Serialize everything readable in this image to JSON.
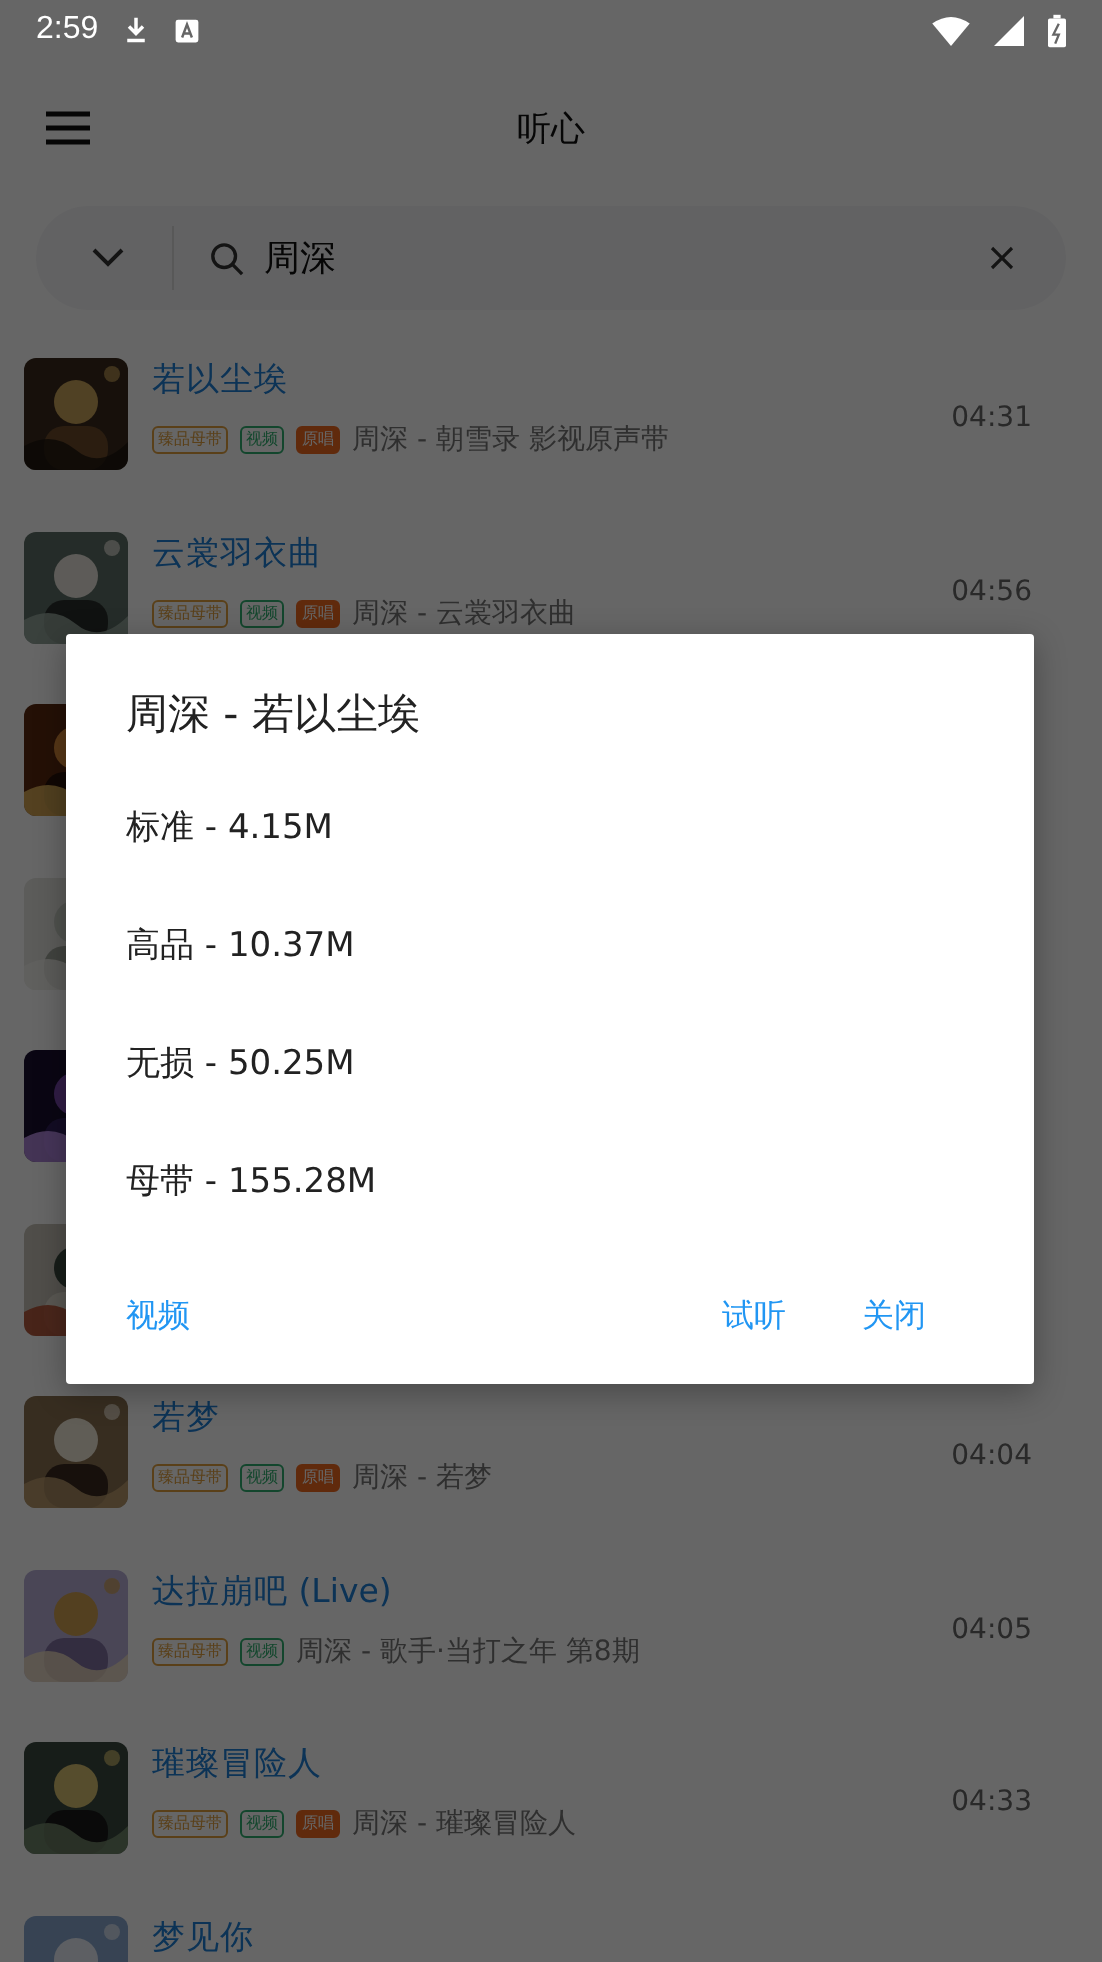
{
  "status_bar": {
    "time": "2:59"
  },
  "app_bar": {
    "title": "听心"
  },
  "search": {
    "value": "周深"
  },
  "songs": [
    {
      "kind": "song",
      "title": "若以尘埃",
      "tags": [
        {
          "label": "臻品母带",
          "kind": "quality"
        },
        {
          "label": "视频",
          "kind": "video"
        },
        {
          "label": "原唱",
          "kind": "original"
        }
      ],
      "subtitle": "周深 - 朝雪录 影视原声带",
      "duration": "04:31"
    },
    {
      "kind": "song",
      "title": "云裳羽衣曲",
      "tags": [
        {
          "label": "臻品母带",
          "kind": "quality"
        },
        {
          "label": "视频",
          "kind": "video"
        },
        {
          "label": "原唱",
          "kind": "original"
        }
      ],
      "subtitle": "周深 - 云裳羽衣曲",
      "duration": "04:56"
    },
    {
      "kind": "covered"
    },
    {
      "kind": "covered"
    },
    {
      "kind": "covered"
    },
    {
      "kind": "covered"
    },
    {
      "kind": "song",
      "title": "若梦",
      "tags": [
        {
          "label": "臻品母带",
          "kind": "quality"
        },
        {
          "label": "视频",
          "kind": "video"
        },
        {
          "label": "原唱",
          "kind": "original"
        }
      ],
      "subtitle": "周深 - 若梦",
      "duration": "04:04"
    },
    {
      "kind": "song",
      "title": "达拉崩吧 (Live)",
      "tags": [
        {
          "label": "臻品母带",
          "kind": "quality"
        },
        {
          "label": "视频",
          "kind": "video"
        }
      ],
      "subtitle": "周深 - 歌手·当打之年 第8期",
      "duration": "04:05"
    },
    {
      "kind": "song",
      "title": "璀璨冒险人",
      "tags": [
        {
          "label": "臻品母带",
          "kind": "quality"
        },
        {
          "label": "视频",
          "kind": "video"
        },
        {
          "label": "原唱",
          "kind": "original"
        }
      ],
      "subtitle": "周深 - 璀璨冒险人",
      "duration": "04:33"
    },
    {
      "kind": "song",
      "title": "梦见你"
    }
  ],
  "dialog": {
    "title": "周深 - 若以尘埃",
    "options": [
      "标准 - 4.15M",
      "高品 - 10.37M",
      "无损 - 50.25M",
      "母带 - 155.28M"
    ],
    "buttons": [
      {
        "label": "视频",
        "kind": "start"
      },
      {
        "label": "试听",
        "kind": "end"
      },
      {
        "label": "关闭",
        "kind": "end"
      }
    ]
  }
}
